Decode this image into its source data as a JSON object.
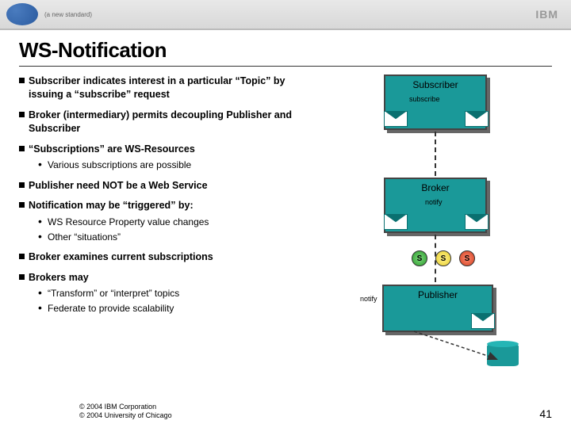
{
  "header": {
    "left_sub": "(a new standard)",
    "ibm": "IBM"
  },
  "title": "WS-Notification",
  "bullets": {
    "b1": "Subscriber indicates interest in a particular “Topic” by issuing a “subscribe” request",
    "b2": "Broker (intermediary) permits decoupling  Publisher and Subscriber",
    "b3": "“Subscriptions” are WS-Resources",
    "b3s1": "Various subscriptions are possible",
    "b4": "Publisher need NOT be a Web Service",
    "b5": "Notification may be “triggered” by:",
    "b5s1": "WS Resource Property value changes",
    "b5s2": "Other “situations”",
    "b6": "Broker examines current subscriptions",
    "b7": "Brokers may",
    "b7s1": "“Transform” or “interpret” topics",
    "b7s2": "Federate to provide scalability"
  },
  "diagram": {
    "subscriber": "Subscriber",
    "broker": "Broker",
    "publisher": "Publisher",
    "subscribe": "subscribe",
    "notify1": "notify",
    "notify2": "notify",
    "s": "S"
  },
  "footer": {
    "l1": "© 2004 IBM Corporation",
    "l2": "© 2004 University of Chicago"
  },
  "page": "41"
}
